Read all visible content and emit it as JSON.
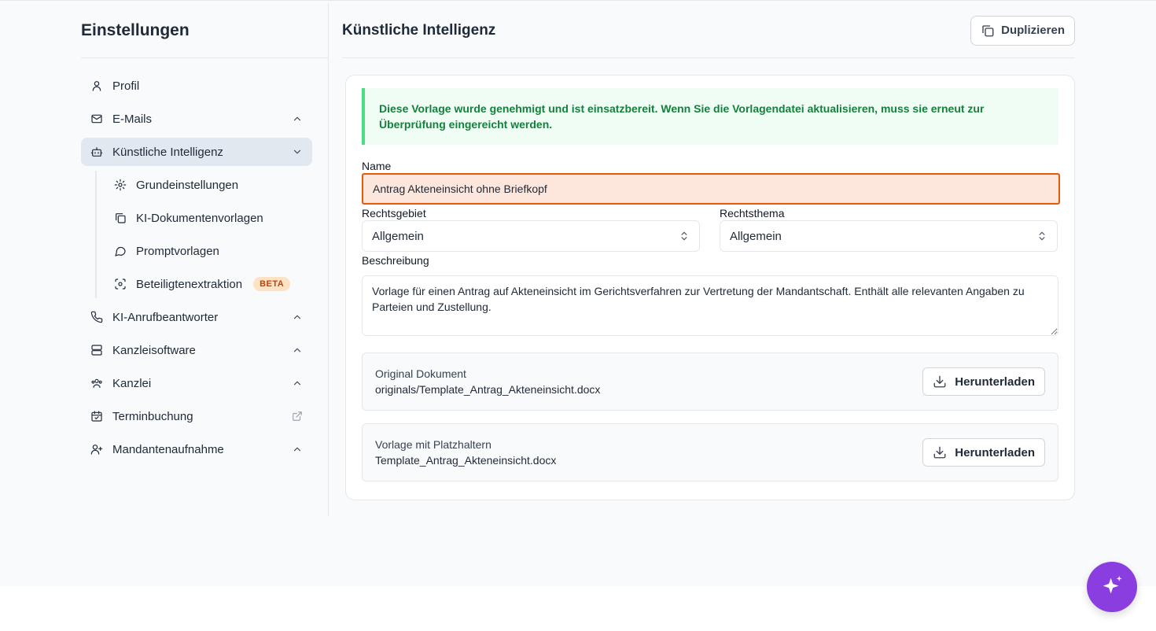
{
  "sidebar": {
    "title": "Einstellungen",
    "items": [
      {
        "label": "Profil",
        "icon": "user-icon"
      },
      {
        "label": "E-Mails",
        "icon": "mail-icon"
      },
      {
        "label": "Künstliche Intelligenz",
        "icon": "bot-icon"
      },
      {
        "label": "KI-Anrufbeantworter",
        "icon": "phone-icon"
      },
      {
        "label": "Kanzleisoftware",
        "icon": "server-icon"
      },
      {
        "label": "Kanzlei",
        "icon": "users-icon"
      },
      {
        "label": "Terminbuchung",
        "icon": "calendar-check-icon"
      },
      {
        "label": "Mandantenaufnahme",
        "icon": "user-plus-icon"
      }
    ],
    "sub_items": [
      {
        "label": "Grundeinstellungen",
        "icon": "gear-icon"
      },
      {
        "label": "KI-Dokumentenvorlagen",
        "icon": "copy-icon"
      },
      {
        "label": "Promptvorlagen",
        "icon": "chat-bubble-icon"
      },
      {
        "label": "Beteiligtenextraktion",
        "icon": "scan-face-icon",
        "badge": "BETA"
      }
    ]
  },
  "main": {
    "title": "Künstliche Intelligenz",
    "duplicate_label": "Duplizieren",
    "alert": "Diese Vorlage wurde genehmigt und ist einsatzbereit. Wenn Sie die Vorlagendatei aktualisieren, muss sie erneut zur Überprüfung eingereicht werden.",
    "name_label": "Name",
    "name_value": "Antrag Akteneinsicht ohne Briefkopf",
    "rechtsgebiet_label": "Rechtsgebiet",
    "rechtsgebiet_value": "Allgemein",
    "rechtsthema_label": "Rechtsthema",
    "rechtsthema_value": "Allgemein",
    "beschreibung_label": "Beschreibung",
    "beschreibung_value": "Vorlage für einen Antrag auf Akteneinsicht im Gerichtsverfahren zur Vertretung der Mandantschaft. Enthält alle relevanten Angaben zu Parteien und Zustellung.",
    "files": [
      {
        "title": "Original Dokument",
        "path": "originals/Template_Antrag_Akteneinsicht.docx",
        "button": "Herunterladen"
      },
      {
        "title": "Vorlage mit Platzhaltern",
        "path": "Template_Antrag_Akteneinsicht.docx",
        "button": "Herunterladen"
      }
    ]
  },
  "colors": {
    "accent_fab": "#8b3ee0",
    "alert_green": "#15803d",
    "error_border": "#ea580c",
    "badge_bg": "#fde2c4"
  },
  "fab_icon": "sparkle-icon"
}
